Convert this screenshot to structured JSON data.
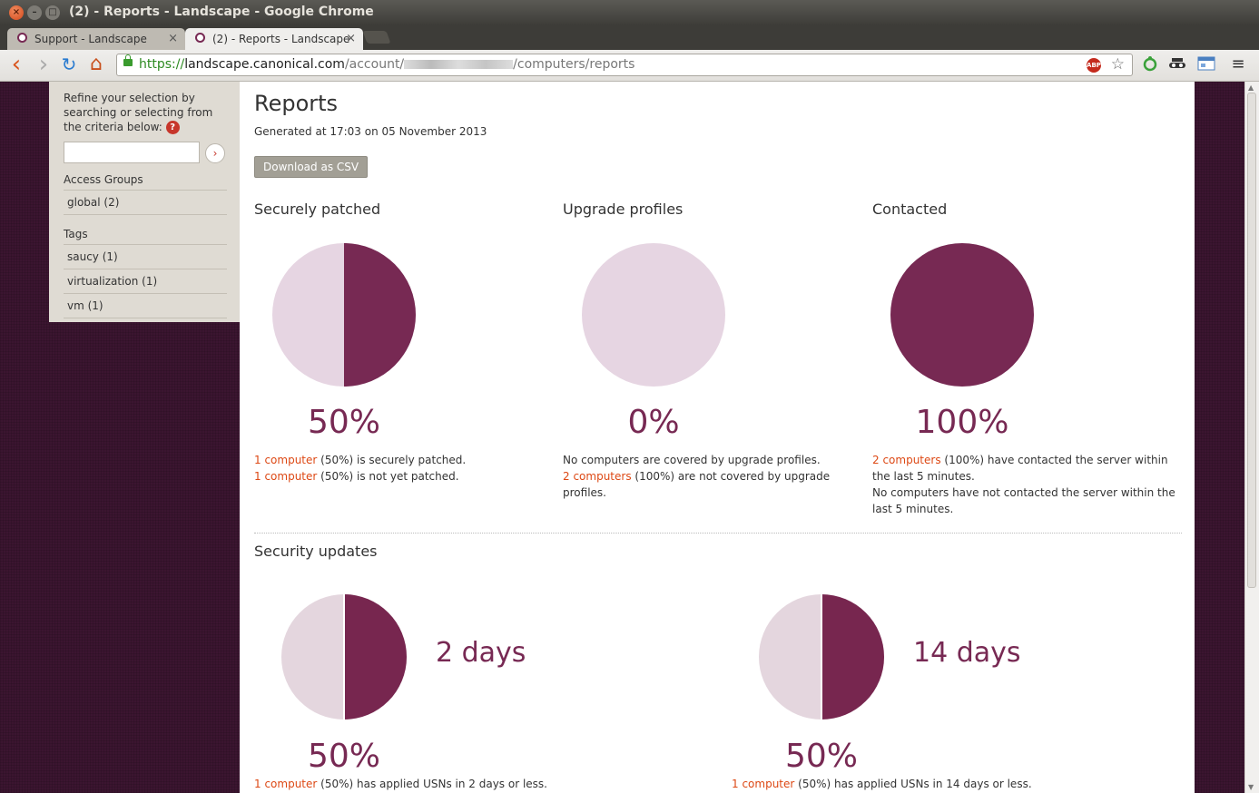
{
  "window": {
    "title": "(2) - Reports - Landscape - Google Chrome",
    "close_glyph": "×",
    "min_glyph": "–",
    "max_glyph": "□"
  },
  "tabs": [
    {
      "label": "Support - Landscape",
      "close": "×"
    },
    {
      "label": "(2) - Reports - Landscape",
      "close": "×"
    }
  ],
  "toolbar": {
    "back_icon": "‹",
    "forward_icon": "›",
    "reload_icon": "↻",
    "home_icon": "⌂",
    "url_scheme": "https://",
    "url_host": "landscape.canonical.com",
    "url_path_prefix": "/account/",
    "url_path_suffix": "/computers/reports",
    "abp_label": "ABP",
    "star_icon": "☆",
    "menu_icon": "≡"
  },
  "sidebar": {
    "refine_text": "Refine your selection by searching or selecting from the criteria below:",
    "help_label": "?",
    "search_value": "",
    "search_go": "›",
    "access_groups_label": "Access Groups",
    "access_groups": [
      "global (2)"
    ],
    "tags_label": "Tags",
    "tags": [
      "saucy (1)",
      "virtualization (1)",
      "vm (1)"
    ]
  },
  "report": {
    "title": "Reports",
    "generated": "Generated at 17:03 on 05 November 2013",
    "download_label": "Download as CSV",
    "securely_patched": {
      "title": "Securely patched",
      "percent_label": "50%",
      "fraction": 0.5,
      "line1_link": "1 computer",
      "line1_text": " (50%) is securely patched.",
      "line2_link": "1 computer",
      "line2_text": " (50%) is not yet patched."
    },
    "upgrade_profiles": {
      "title": "Upgrade profiles",
      "percent_label": "0%",
      "fraction": 0.0,
      "line1_text": "No computers are covered by upgrade profiles.",
      "line2_link": "2 computers",
      "line2_text": " (100%) are not covered by upgrade profiles."
    },
    "contacted": {
      "title": "Contacted",
      "percent_label": "100%",
      "fraction": 1.0,
      "line1_link": "2 computers",
      "line1_text": " (100%) have contacted the server within the last 5 minutes.",
      "line2_text": "No computers have not contacted the server within the last 5 minutes."
    },
    "security_updates": {
      "title": "Security updates",
      "items": [
        {
          "days_label": "2 days",
          "percent_label": "50%",
          "fraction": 0.5,
          "link": "1 computer",
          "text": " (50%) has applied USNs in 2 days or less."
        },
        {
          "days_label": "14 days",
          "percent_label": "50%",
          "fraction": 0.5,
          "link": "1 computer",
          "text": " (50%) has applied USNs in 14 days or less."
        }
      ]
    }
  },
  "colors": {
    "aubergine": "#772953",
    "aubergine_dark": "#77264f",
    "pie_light": "#e6d5e2",
    "pie_light_alt": "#e4d6de",
    "link": "#dd4814"
  }
}
